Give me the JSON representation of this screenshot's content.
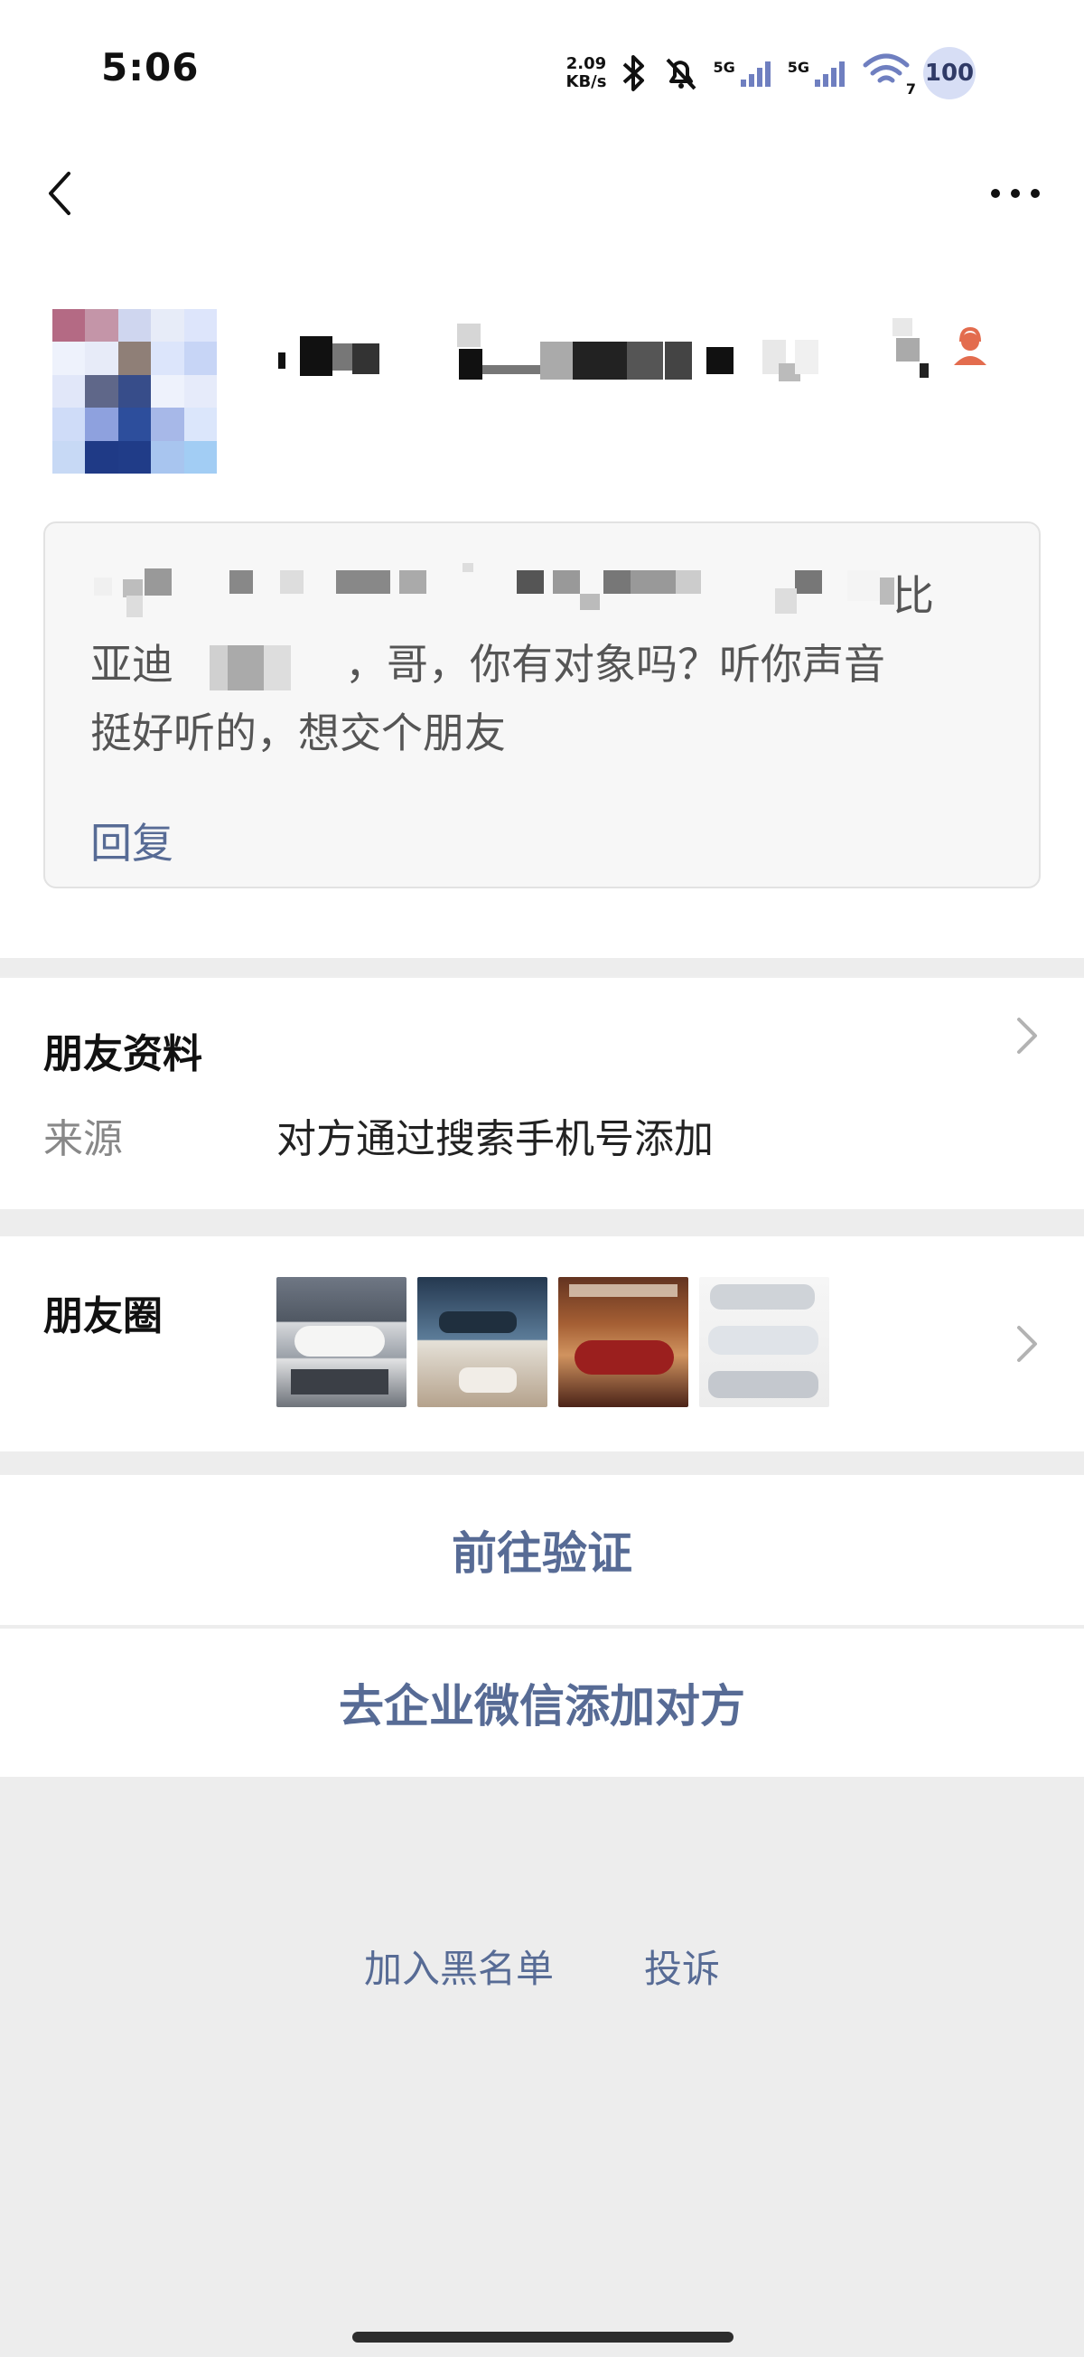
{
  "status_bar": {
    "time": "5:06",
    "speed_value": "2.09",
    "speed_unit": "KB/s",
    "network_1": "5G",
    "network_2": "5G",
    "wifi_label": "7",
    "battery": "100"
  },
  "nav": {
    "back_icon": "chevron-left-icon",
    "more_icon": "more-dots-icon"
  },
  "profile": {
    "greeting": {
      "line1_tail": "比",
      "line2": "亚迪",
      "line2_rest": "，哥，你有对象吗？听你声音",
      "line3": "挺好听的，想交个朋友",
      "reply_label": "回复"
    }
  },
  "friend_info": {
    "title": "朋友资料",
    "source_label": "来源",
    "source_value": "对方通过搜索手机号添加"
  },
  "moments": {
    "title": "朋友圈"
  },
  "actions": {
    "verify_label": "前往验证",
    "enterprise_label": "去企业微信添加对方"
  },
  "bottom": {
    "blacklist_label": "加入黑名单",
    "complaint_label": "投诉"
  },
  "colors": {
    "accent": "#576b95",
    "background": "#ededed",
    "card": "#f7f7f7"
  }
}
